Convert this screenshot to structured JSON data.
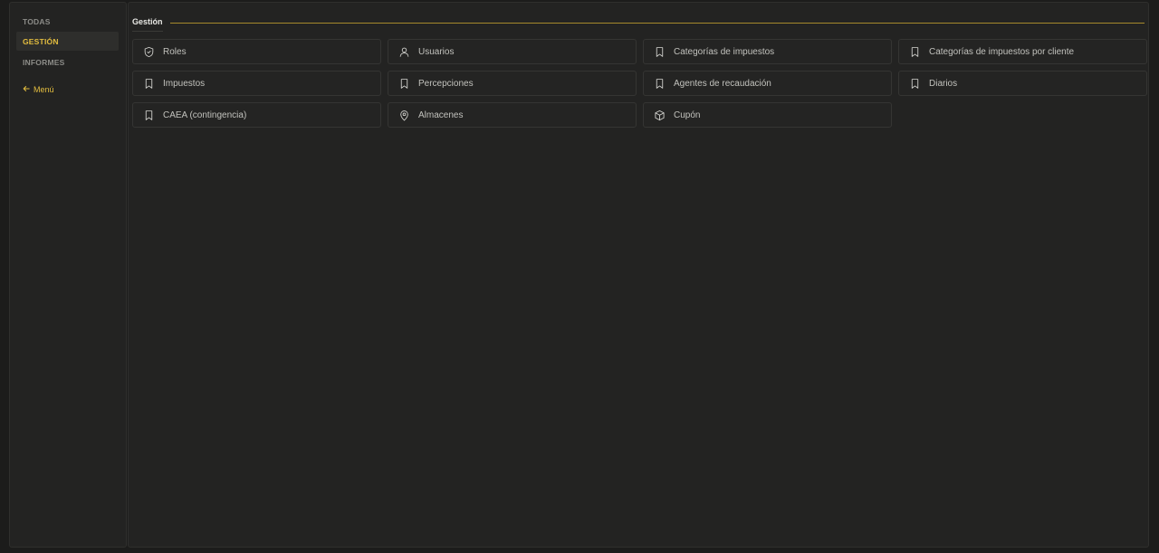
{
  "sidebar": {
    "items": [
      {
        "label": "TODAS",
        "active": false
      },
      {
        "label": "GESTIÓN",
        "active": true
      },
      {
        "label": "INFORMES",
        "active": false
      }
    ],
    "back_label": "Menú"
  },
  "section": {
    "title": "Gestión"
  },
  "cards": [
    {
      "label": "Roles",
      "icon": "shield-icon"
    },
    {
      "label": "Usuarios",
      "icon": "user-icon"
    },
    {
      "label": "Categorías de impuestos",
      "icon": "bookmark-icon"
    },
    {
      "label": "Categorías de impuestos por cliente",
      "icon": "bookmark-icon"
    },
    {
      "label": "Impuestos",
      "icon": "bookmark-icon"
    },
    {
      "label": "Percepciones",
      "icon": "bookmark-icon"
    },
    {
      "label": "Agentes de recaudación",
      "icon": "bookmark-icon"
    },
    {
      "label": "Diarios",
      "icon": "bookmark-icon"
    },
    {
      "label": "CAEA (contingencia)",
      "icon": "bookmark-icon"
    },
    {
      "label": "Almacenes",
      "icon": "map-pin-icon"
    },
    {
      "label": "Cupón",
      "icon": "package-icon"
    }
  ],
  "colors": {
    "accent": "#e3bd3f",
    "background": "#1c1c1b",
    "panel": "#232322"
  }
}
